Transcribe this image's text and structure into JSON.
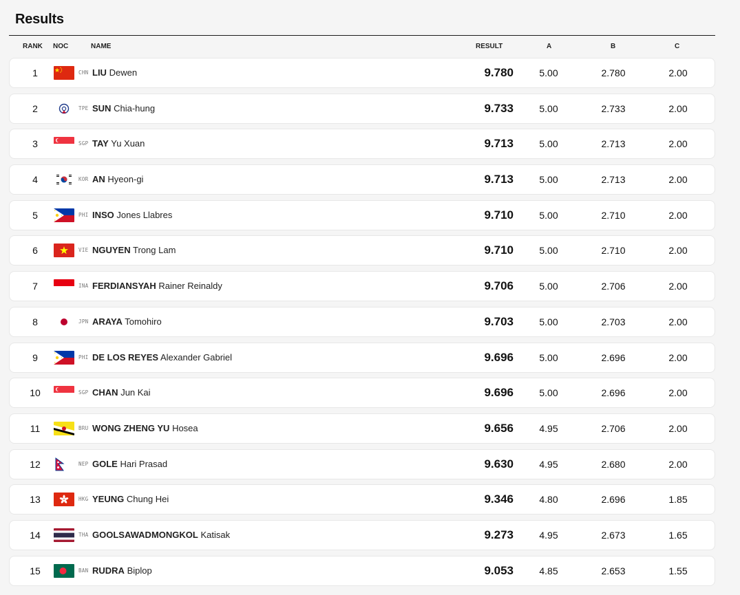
{
  "title": "Results",
  "columns": {
    "rank": "RANK",
    "noc": "NOC",
    "name": "NAME",
    "result": "RESULT",
    "a": "A",
    "b": "B",
    "c": "C"
  },
  "rows": [
    {
      "rank": "1",
      "noc": "CHN",
      "flag": "china-flag-icon",
      "last": "LIU",
      "first": "Dewen",
      "result": "9.780",
      "a": "5.00",
      "b": "2.780",
      "c": "2.00"
    },
    {
      "rank": "2",
      "noc": "TPE",
      "flag": "chinese-taipei-flag-icon",
      "last": "SUN",
      "first": "Chia-hung",
      "result": "9.733",
      "a": "5.00",
      "b": "2.733",
      "c": "2.00"
    },
    {
      "rank": "3",
      "noc": "SGP",
      "flag": "singapore-flag-icon",
      "last": "TAY",
      "first": "Yu Xuan",
      "result": "9.713",
      "a": "5.00",
      "b": "2.713",
      "c": "2.00"
    },
    {
      "rank": "4",
      "noc": "KOR",
      "flag": "korea-flag-icon",
      "last": "AN",
      "first": "Hyeon-gi",
      "result": "9.713",
      "a": "5.00",
      "b": "2.713",
      "c": "2.00"
    },
    {
      "rank": "5",
      "noc": "PHI",
      "flag": "philippines-flag-icon",
      "last": "INSO",
      "first": "Jones Llabres",
      "result": "9.710",
      "a": "5.00",
      "b": "2.710",
      "c": "2.00"
    },
    {
      "rank": "6",
      "noc": "VIE",
      "flag": "vietnam-flag-icon",
      "last": "NGUYEN",
      "first": "Trong Lam",
      "result": "9.710",
      "a": "5.00",
      "b": "2.710",
      "c": "2.00"
    },
    {
      "rank": "7",
      "noc": "INA",
      "flag": "indonesia-flag-icon",
      "last": "FERDIANSYAH",
      "first": "Rainer Reinaldy",
      "result": "9.706",
      "a": "5.00",
      "b": "2.706",
      "c": "2.00"
    },
    {
      "rank": "8",
      "noc": "JPN",
      "flag": "japan-flag-icon",
      "last": "ARAYA",
      "first": "Tomohiro",
      "result": "9.703",
      "a": "5.00",
      "b": "2.703",
      "c": "2.00"
    },
    {
      "rank": "9",
      "noc": "PHI",
      "flag": "philippines-flag-icon",
      "last": "DE LOS REYES",
      "first": "Alexander Gabriel",
      "result": "9.696",
      "a": "5.00",
      "b": "2.696",
      "c": "2.00"
    },
    {
      "rank": "10",
      "noc": "SGP",
      "flag": "singapore-flag-icon",
      "last": "CHAN",
      "first": "Jun Kai",
      "result": "9.696",
      "a": "5.00",
      "b": "2.696",
      "c": "2.00"
    },
    {
      "rank": "11",
      "noc": "BRU",
      "flag": "brunei-flag-icon",
      "last": "WONG ZHENG YU",
      "first": "Hosea",
      "result": "9.656",
      "a": "4.95",
      "b": "2.706",
      "c": "2.00"
    },
    {
      "rank": "12",
      "noc": "NEP",
      "flag": "nepal-flag-icon",
      "last": "GOLE",
      "first": "Hari Prasad",
      "result": "9.630",
      "a": "4.95",
      "b": "2.680",
      "c": "2.00"
    },
    {
      "rank": "13",
      "noc": "HKG",
      "flag": "hong-kong-flag-icon",
      "last": "YEUNG",
      "first": "Chung Hei",
      "result": "9.346",
      "a": "4.80",
      "b": "2.696",
      "c": "1.85"
    },
    {
      "rank": "14",
      "noc": "THA",
      "flag": "thailand-flag-icon",
      "last": "GOOLSAWADMONGKOL",
      "first": "Katisak",
      "result": "9.273",
      "a": "4.95",
      "b": "2.673",
      "c": "1.65"
    },
    {
      "rank": "15",
      "noc": "BAN",
      "flag": "bangladesh-flag-icon",
      "last": "RUDRA",
      "first": "Biplop",
      "result": "9.053",
      "a": "4.85",
      "b": "2.653",
      "c": "1.55"
    }
  ]
}
